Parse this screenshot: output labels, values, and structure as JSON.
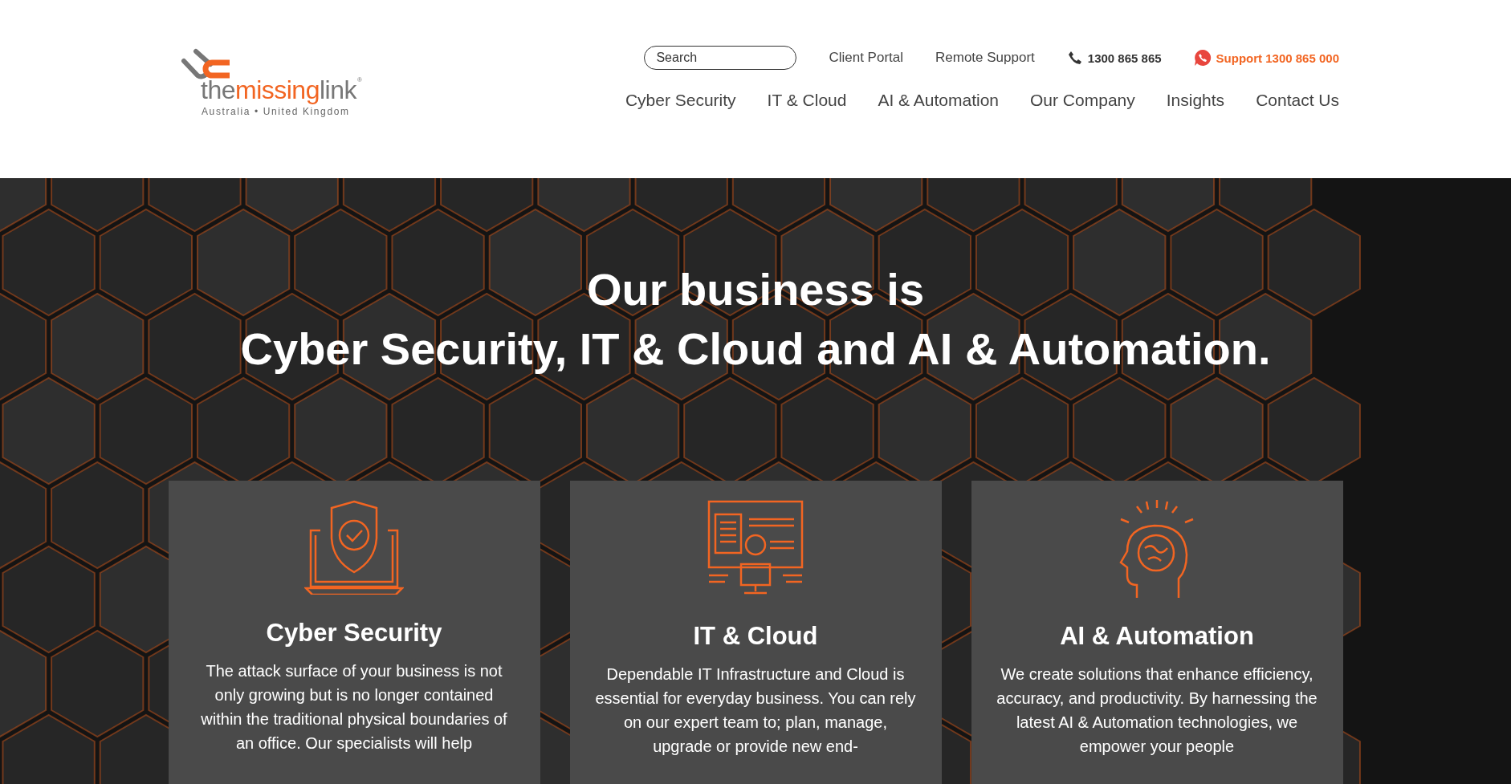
{
  "logo": {
    "wordmark": [
      {
        "text": "the",
        "accent": false
      },
      {
        "text": "missing",
        "accent": true
      },
      {
        "text": "link",
        "accent": false
      }
    ],
    "registered": "®",
    "tagline": "Australia • United Kingdom"
  },
  "utility_bar": {
    "search": {
      "placeholder": "Search"
    },
    "links": [
      "Client Portal",
      "Remote Support"
    ],
    "phone": "1300 865 865",
    "support": "Support 1300 865 000"
  },
  "nav": [
    "Cyber Security",
    "IT & Cloud",
    "AI & Automation",
    "Our Company",
    "Insights",
    "Contact Us"
  ],
  "hero": {
    "headline": [
      "Our business is",
      "Cyber Security, IT & Cloud and AI & Automation."
    ]
  },
  "cards": [
    {
      "kind": "shield",
      "title": "Cyber Security",
      "text": "The attack surface of your business is not only growing but is no longer contained within the traditional physical boundaries of an office. Our specialists will help"
    },
    {
      "kind": "monitor",
      "title": "IT & Cloud",
      "text": "Dependable IT Infrastructure and Cloud is essential for everyday business. You can rely on our expert team to; plan, manage, upgrade or provide new end-"
    },
    {
      "kind": "brain",
      "title": "AI & Automation",
      "text": "We create solutions that enhance efficiency, accuracy, and productivity. By harnessing the latest AI & Automation technologies, we empower your people"
    }
  ]
}
